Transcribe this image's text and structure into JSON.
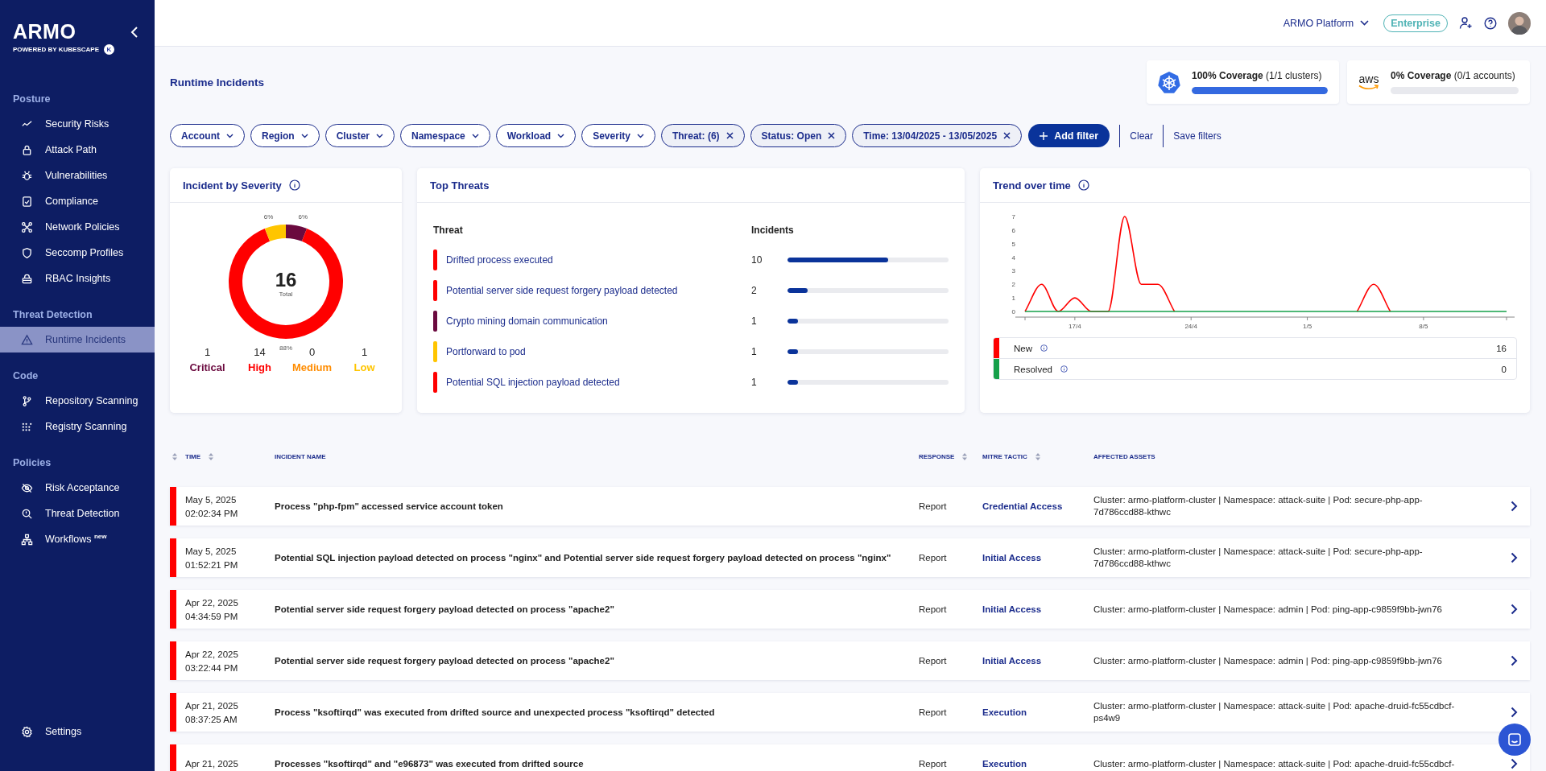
{
  "sidebar": {
    "logo": "ARMO",
    "tagline": "POWERED BY KUBESCAPE",
    "tagline_badge": "K",
    "sections": [
      {
        "title": "Posture",
        "items": [
          {
            "label": "Security Risks",
            "selected": false
          },
          {
            "label": "Attack Path",
            "selected": false
          },
          {
            "label": "Vulnerabilities",
            "selected": false
          },
          {
            "label": "Compliance",
            "selected": false
          },
          {
            "label": "Network Policies",
            "selected": false
          },
          {
            "label": "Seccomp Profiles",
            "selected": false
          },
          {
            "label": "RBAC Insights",
            "selected": false
          }
        ]
      },
      {
        "title": "Threat Detection",
        "items": [
          {
            "label": "Runtime Incidents",
            "selected": true
          }
        ]
      },
      {
        "title": "Code",
        "items": [
          {
            "label": "Repository Scanning",
            "selected": false
          },
          {
            "label": "Registry Scanning",
            "selected": false
          }
        ]
      },
      {
        "title": "Policies",
        "items": [
          {
            "label": "Risk Acceptance",
            "selected": false
          },
          {
            "label": "Threat Detection",
            "selected": false
          },
          {
            "label": "Workflows $^{new}$",
            "selected": false
          }
        ]
      }
    ],
    "footer_item": {
      "label": "Settings",
      "selected": false
    }
  },
  "topbar": {
    "platform": "ARMO Platform",
    "plan": "Enterprise"
  },
  "page_title": "Runtime Incidents",
  "coverage": [
    {
      "kind": "kubernetes",
      "text": "**100% Coverage** (1/1 clusters)",
      "level": 1
    },
    {
      "kind": "aws",
      "logo_text": "aws",
      "text": "**0% Coverage** (0/1 accounts)",
      "level": 0
    }
  ],
  "filters": [
    {
      "label": "Account",
      "kind": "dropdown"
    },
    {
      "label": "Region",
      "kind": "dropdown"
    },
    {
      "label": "Cluster",
      "kind": "dropdown"
    },
    {
      "label": "Namespace",
      "kind": "dropdown"
    },
    {
      "label": "Workload",
      "kind": "dropdown"
    },
    {
      "label": "Severity",
      "kind": "dropdown"
    },
    {
      "label": "Threat: (6)",
      "kind": "applied"
    },
    {
      "label": "Status: Open",
      "kind": "applied"
    },
    {
      "label": "Time: 13/04/2025 - 13/05/2025",
      "kind": "applied"
    }
  ],
  "filter_actions": {
    "add": "Add filter",
    "clear": "Clear",
    "save": "Save filters"
  },
  "severity_card": {
    "title": "Incident by Severity",
    "total": "16",
    "total_label": "Total",
    "chart_data": {
      "type": "donut",
      "categories": [
        "Critical",
        "High",
        "Medium",
        "Low"
      ],
      "values": [
        6,
        88,
        0,
        6
      ],
      "value_labels": [
        "6%",
        "88%",
        null,
        "6%"
      ]
    },
    "legend": [
      {
        "count": "1",
        "color": "#6b0a3f"
      },
      {
        "count": "14",
        "color": "#ff0000"
      },
      {
        "count": "0",
        "color": "#ff8c00"
      },
      {
        "count": "1",
        "color": "#ffc500"
      }
    ]
  },
  "threats_card": {
    "title": "Top Threats",
    "columns": [
      "Threat",
      "Incidents"
    ],
    "rows": [
      {
        "name": "Drifted process executed",
        "count": "10",
        "level": 0.625,
        "color": "#ff0000"
      },
      {
        "name": "Potential server side request forgery payload detected",
        "count": "2",
        "level": 0.125,
        "color": "#ff0000"
      },
      {
        "name": "Crypto mining domain communication",
        "count": "1",
        "level": 0.0625,
        "color": "#6b0a3f"
      },
      {
        "name": "Portforward to pod",
        "count": "1",
        "level": 0.0625,
        "color": "#ffc500"
      },
      {
        "name": "Potential SQL injection payload detected",
        "count": "1",
        "level": 0.0625,
        "color": "#ff0000"
      }
    ]
  },
  "trend_card": {
    "title": "Trend over time",
    "chart_data": {
      "type": "line",
      "categories": [
        null,
        null,
        null,
        "17/4",
        null,
        null,
        null,
        null,
        null,
        null,
        "24/4",
        null,
        null,
        null,
        null,
        null,
        null,
        "1/5",
        null,
        null,
        null,
        null,
        null,
        null,
        "8/5",
        null,
        null,
        null,
        null,
        null
      ],
      "ylim": [
        0,
        7
      ],
      "yticks": [
        0,
        1,
        2,
        3,
        4,
        5,
        6,
        7
      ],
      "series": [
        {
          "name": "New",
          "color": "#ff0000",
          "values": [
            0,
            2,
            0,
            1,
            0,
            0,
            7,
            2,
            2,
            0,
            null,
            null,
            null,
            null,
            null,
            null,
            null,
            null,
            null,
            null,
            0,
            2,
            0,
            null,
            null,
            null,
            null,
            null,
            null,
            null
          ]
        },
        {
          "name": "Resolved",
          "color": "#15a04a",
          "values": [
            0,
            0,
            0,
            0,
            0,
            0,
            0,
            0,
            0,
            0,
            0,
            0,
            0,
            0,
            0,
            0,
            0,
            0,
            0,
            0,
            0,
            0,
            0,
            0,
            0,
            0,
            0,
            0,
            0,
            0
          ]
        }
      ]
    },
    "legend_counts": [
      "16",
      "0"
    ]
  },
  "table": {
    "columns": [
      {
        "label": "TIME",
        "sortable": true
      },
      {
        "label": "INCIDENT NAME",
        "sortable": false
      },
      {
        "label": "RESPONSE",
        "sortable": true
      },
      {
        "label": "MITRE TACTIC",
        "sortable": true
      },
      {
        "label": "AFFECTED ASSETS",
        "sortable": false
      }
    ],
    "rows": [
      {
        "color": "#ff0000",
        "date": "May 5, 2025",
        "time": "02:02:34 PM",
        "name": "Process \"php-fpm\" accessed service account token",
        "response": "Report",
        "tactic": "Credential Access",
        "assets": "Cluster: armo-platform-cluster | Namespace: attack-suite | Pod: secure-php-app-7d786ccd88-kthwc"
      },
      {
        "color": "#ff0000",
        "date": "May 5, 2025",
        "time": "01:52:21 PM",
        "name": "Potential SQL injection payload detected on process \"nginx\" and Potential server side request forgery payload detected on process \"nginx\"",
        "response": "Report",
        "tactic": "Initial Access",
        "assets": "Cluster: armo-platform-cluster | Namespace: attack-suite | Pod: secure-php-app-7d786ccd88-kthwc"
      },
      {
        "color": "#ff0000",
        "date": "Apr 22, 2025",
        "time": "04:34:59 PM",
        "name": "Potential server side request forgery payload detected on process \"apache2\"",
        "response": "Report",
        "tactic": "Initial Access",
        "assets": "Cluster: armo-platform-cluster | Namespace: admin | Pod: ping-app-c9859f9bb-jwn76"
      },
      {
        "color": "#ff0000",
        "date": "Apr 22, 2025",
        "time": "03:22:44 PM",
        "name": "Potential server side request forgery payload detected on process \"apache2\"",
        "response": "Report",
        "tactic": "Initial Access",
        "assets": "Cluster: armo-platform-cluster | Namespace: admin | Pod: ping-app-c9859f9bb-jwn76"
      },
      {
        "color": "#ff0000",
        "date": "Apr 21, 2025",
        "time": "08:37:25 AM",
        "name": "Process \"ksoftirqd\" was executed from drifted source and unexpected process \"ksoftirqd\" detected",
        "response": "Report",
        "tactic": "Execution",
        "assets": "Cluster: armo-platform-cluster | Namespace: attack-suite | Pod: apache-druid-fc55cdbcf-ps4w9"
      },
      {
        "color": "#ff0000",
        "date": "Apr 21, 2025",
        "name": "Processes \"ksoftirqd\" and \"e96873\" was executed from drifted source",
        "response": "Report",
        "tactic": "Execution",
        "assets": "Cluster: armo-platform-cluster | Namespace: attack-suite | Pod: apache-druid-fc55cdbcf-"
      }
    ]
  }
}
